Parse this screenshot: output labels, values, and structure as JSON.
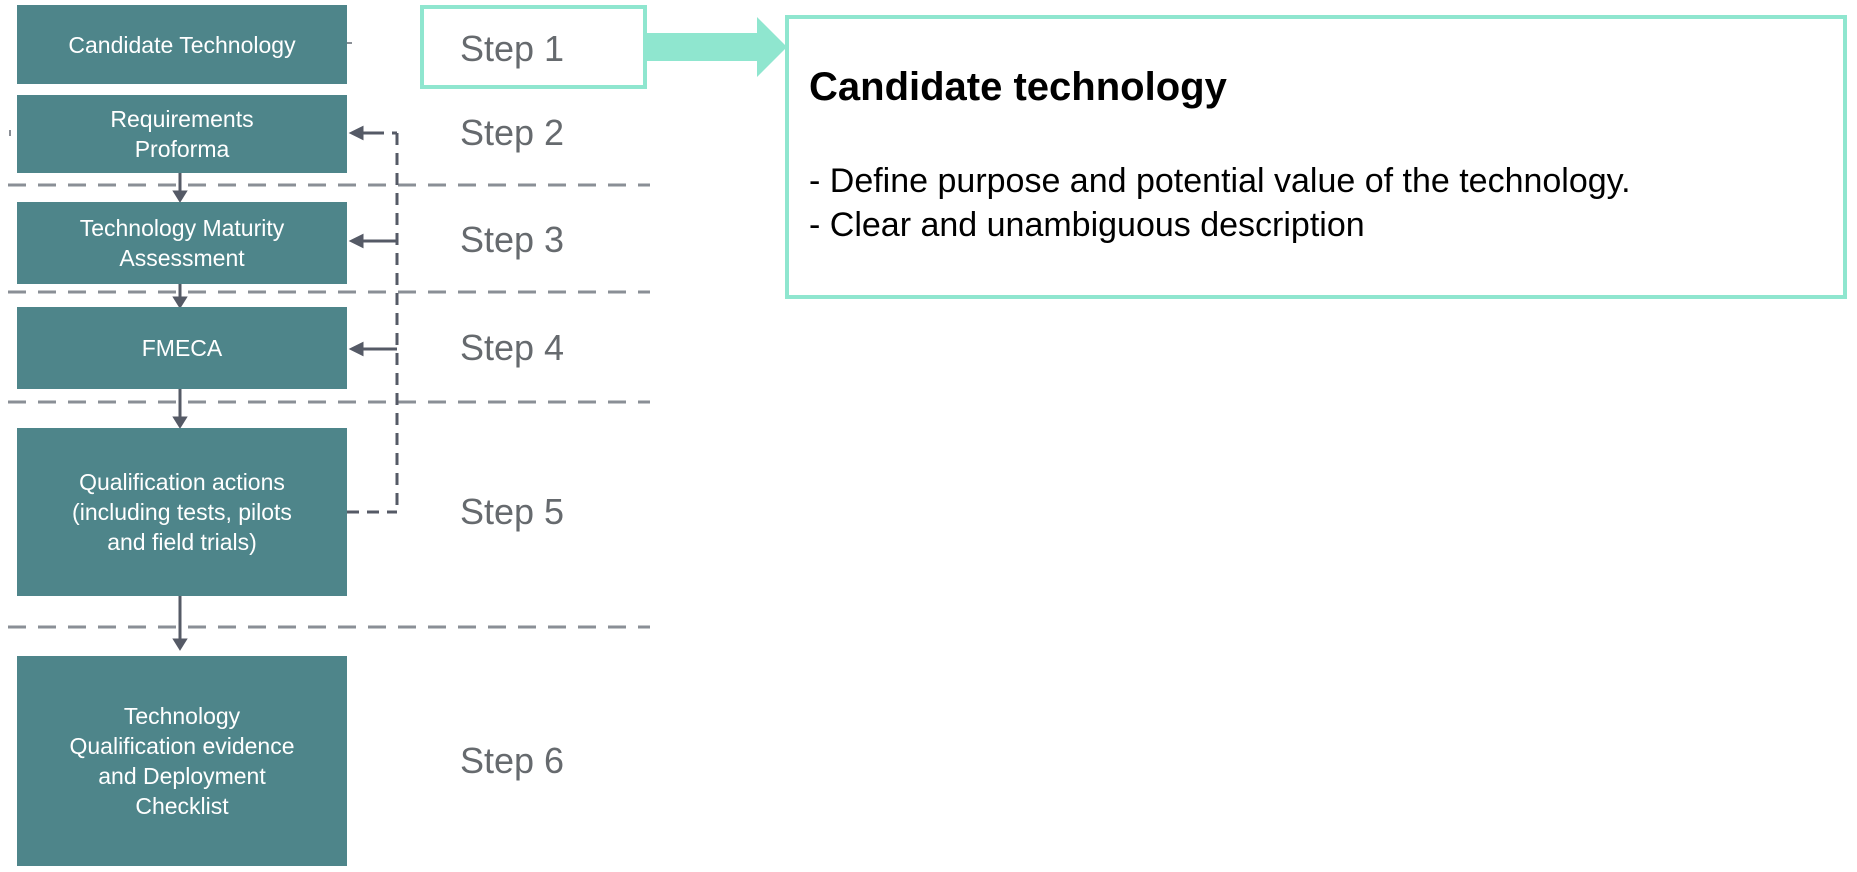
{
  "flow": {
    "boxes": [
      {
        "label": "Candidate Technology"
      },
      {
        "label": "Requirements\nProforma"
      },
      {
        "label": "Technology Maturity\nAssessment"
      },
      {
        "label": "FMECA"
      },
      {
        "label": "Qualification actions\n(including tests, pilots\nand field trials)"
      },
      {
        "label": "Technology\nQualification evidence\nand Deployment\nChecklist"
      }
    ],
    "steps": [
      "Step 1",
      "Step 2",
      "Step 3",
      "Step 4",
      "Step 5",
      "Step 6"
    ]
  },
  "callout": {
    "title": "Candidate technology",
    "bullets": [
      "- Define purpose and potential value of the technology.",
      "- Clear and unambiguous description"
    ]
  },
  "colors": {
    "box_fill": "#4e858a",
    "highlight": "#8fe6cf",
    "dash": "#8a8f96",
    "connector": "#555a66"
  }
}
